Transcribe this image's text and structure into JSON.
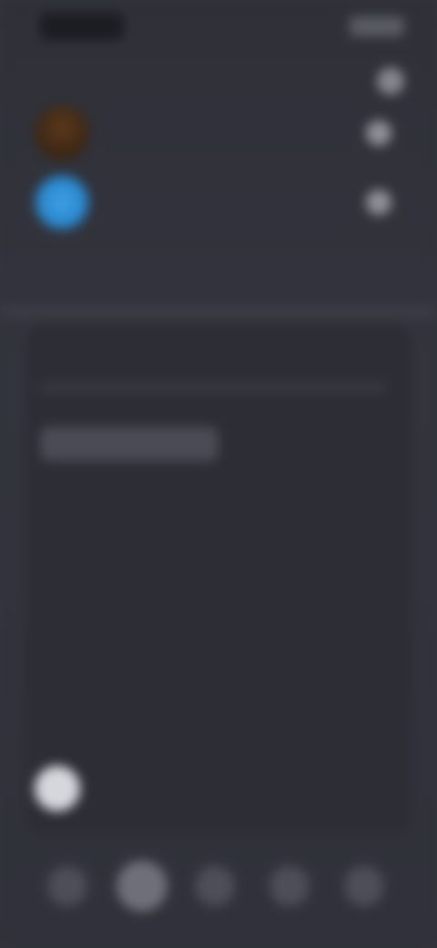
{
  "status_bar": {
    "time": ""
  },
  "header": {
    "title": ""
  },
  "accounts": {
    "items": [
      {
        "name": "",
        "avatar_color": "#4a2e16"
      },
      {
        "name": "",
        "avatar_color": "#2f8fd6"
      }
    ],
    "more_label": ""
  },
  "card": {
    "title": "",
    "tabs": [
      "",
      ""
    ],
    "month_label": "",
    "month_action": "",
    "weekdays": [
      "",
      "",
      "",
      "",
      "",
      "",
      ""
    ],
    "days": [
      [
        "",
        "",
        "",
        "",
        "",
        "",
        ""
      ],
      [
        "",
        "",
        "",
        "",
        "",
        "",
        ""
      ],
      [
        "",
        "",
        "",
        "",
        "",
        "",
        ""
      ],
      [
        "",
        "",
        "",
        "",
        "",
        "",
        ""
      ],
      [
        "",
        "",
        "",
        "",
        "",
        "",
        ""
      ]
    ],
    "today_index": [
      4,
      0
    ]
  },
  "bottom_nav": {
    "items": [
      "",
      "",
      "",
      "",
      ""
    ],
    "active_index": 1
  },
  "colors": {
    "background": "#33343d",
    "card": "#2c2d35",
    "accent_blue": "#2f8fd6",
    "accent_brown": "#4a2e16"
  }
}
